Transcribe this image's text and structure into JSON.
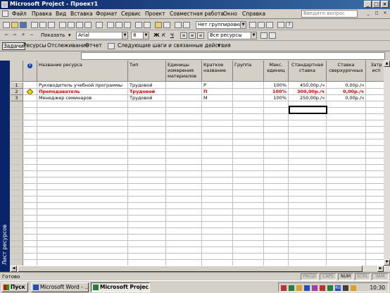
{
  "window": {
    "title": "Microsoft Project - Проект1"
  },
  "menu": {
    "items": [
      "Файл",
      "Правка",
      "Вид",
      "Вставка",
      "Формат",
      "Сервис",
      "Проект",
      "Совместная работа",
      "Окно",
      "Справка"
    ],
    "ask_placeholder": "Введите вопрос"
  },
  "toolbar": {
    "grouping": "Нет группировки",
    "show_label": "Показать",
    "font": "Arial",
    "font_size": "8",
    "bold": "Ж",
    "italic": "К",
    "underline": "Ч",
    "filter": "Все ресурсы"
  },
  "guide": {
    "items": [
      "Задачи",
      "Ресурсы",
      "Отслеживание",
      "Отчет"
    ],
    "next_steps": "Следующие шаги и связанные действия"
  },
  "view": {
    "label": "Лист ресурсов"
  },
  "table": {
    "headers": {
      "name": "Название ресурса",
      "type": "Тип",
      "material_units": "Единицы измерения материалов",
      "initials": "Краткое название",
      "group": "Группа",
      "max_units": "Макс. единиц",
      "std_rate": "Стандартная ставка",
      "ovt_rate": "Ставка сверхурочных",
      "cost_use": "Затр исп"
    },
    "rows": [
      {
        "id": "1",
        "name": "Руководитель учебной программы",
        "type": "Трудовой",
        "initials": "Р",
        "max_units": "100%",
        "std_rate": "450,00р./ч",
        "ovt_rate": "0,00р./ч",
        "overallocated": false
      },
      {
        "id": "2",
        "name": "Преподаватель",
        "type": "Трудовой",
        "initials": "П",
        "max_units": "100%",
        "std_rate": "300,00р./ч",
        "ovt_rate": "0,00р./ч",
        "overallocated": true
      },
      {
        "id": "3",
        "name": "Менеджер семинаров",
        "type": "Трудовой",
        "initials": "М",
        "max_units": "100%",
        "std_rate": "250,00р./ч",
        "ovt_rate": "0,00р./ч",
        "overallocated": false
      }
    ]
  },
  "status": {
    "text": "Готово",
    "indicators": [
      "РАСШ",
      "CAPS",
      "NUM",
      "SCRL",
      "ЗАМ"
    ]
  },
  "taskbar": {
    "start": "Пуск",
    "buttons": [
      "Microsoft Word - ...",
      "Microsoft Projec..."
    ],
    "clock": "10:30"
  },
  "colors": {
    "titlebar": "#0a246a",
    "overallocated": "#e00000"
  }
}
